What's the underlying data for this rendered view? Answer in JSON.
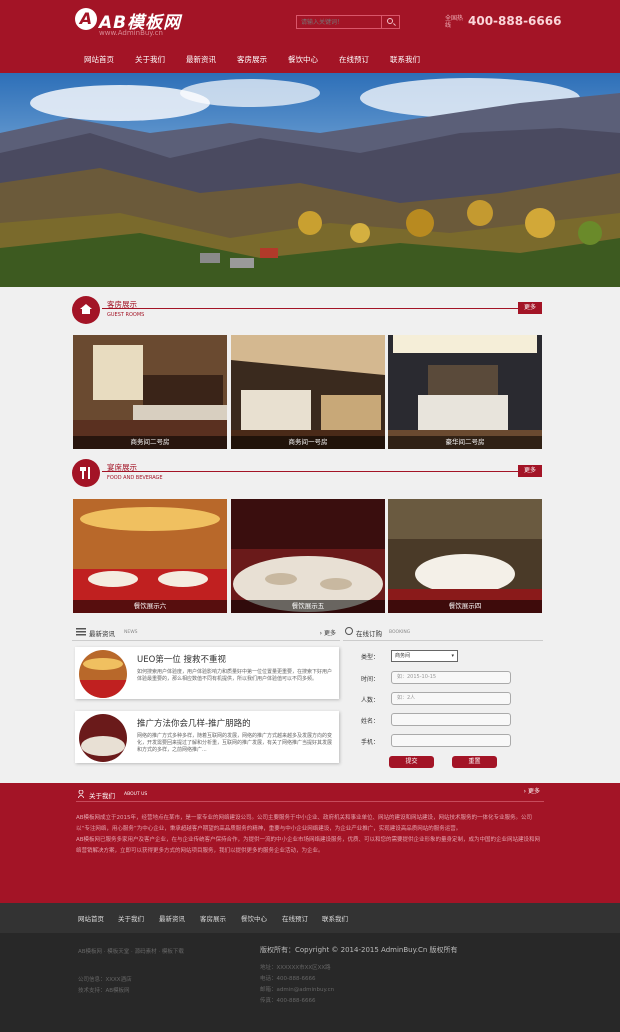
{
  "header": {
    "logo_mark": "A",
    "logo_text": "AB模板网",
    "logo_sub": "www.AdminBuy.cn",
    "search_placeholder": "请输入关键词！",
    "hotline_label": "全国热线",
    "phone": "400-888-6666"
  },
  "nav": [
    "网站首页",
    "关于我们",
    "最新资讯",
    "客房展示",
    "餐饮中心",
    "在线预订",
    "联系我们"
  ],
  "rooms": {
    "title": "客房展示",
    "subtitle": "GUEST ROOMS",
    "more": "更多",
    "items": [
      {
        "caption": "商务间二号房"
      },
      {
        "caption": "商务间一号房"
      },
      {
        "caption": "豪华间二号房"
      }
    ]
  },
  "food": {
    "title": "宴席展示",
    "subtitle": "FOOD AND BEVERAGE",
    "more": "更多",
    "items": [
      {
        "caption": "餐饮展示六"
      },
      {
        "caption": "餐饮展示五"
      },
      {
        "caption": "餐饮展示四"
      }
    ]
  },
  "news": {
    "title": "最新资讯",
    "title_en": "NEWS",
    "more": "更多",
    "items": [
      {
        "title": "UEO第一位 搜救不重视",
        "text": "如何搜索用户体验度，用户体验影响力和质量好中第一位位置量更重要，在搜索下好用户体验最重要的，那么相应数值不同有机提供，所以我们用户体验值可以不同多频。"
      },
      {
        "title": "推广方法你会几样-推广朋路的",
        "text": "网络的推广方式多种多样，随着互联网的发展，网络的推广方式越来越多及发展方向的变化，开发需要回来提过了解和分析重，互联网的推广发展，有关了网络推广当提好其发展和方式的多样，之前网络推广..."
      }
    ]
  },
  "booking": {
    "title": "在线订购",
    "title_en": "BOOKING",
    "fields": [
      {
        "label": "类型：",
        "value": "商务间"
      },
      {
        "label": "时间：",
        "value": "如：2015-10-15"
      },
      {
        "label": "人数：",
        "value": "如：2人"
      },
      {
        "label": "姓名：",
        "value": ""
      },
      {
        "label": "手机：",
        "value": ""
      }
    ],
    "submit": "提交",
    "reset": "重置"
  },
  "about": {
    "title": "关于我们",
    "title_en": "ABOUT US",
    "more": "更多",
    "text1": "AB模板网成立于2015年，经营地点在某市，是一家专业的网络建设公司。公司主要服务于中小企业、政府机关和事业单位、网站的建设和网站建设，网站技术服务的一体化专业服务。公司以“专注网络，用心服务”为中心企业，秉承超越客户期望的高品质服务的精神，重要与中小企业网络建设，为企业产业推广，实现建设高品质网站的服务运营。",
    "text2": "AB模板网已服务多家用户及客户企业，在与企业传统客户保持合作，为提供一流的中小企业市场网络建设服务，优质、可以和您的需要提供企业形象的量身定制，成为中国的企业网站建设和网络营销解决方案，立即可以获得更多方式的网站项目服务，我们以提供更多的服务企业活动，为企业。"
  },
  "footer_nav": [
    "网站首页",
    "关于我们",
    "最新资讯",
    "客房展示",
    "餐饮中心",
    "在线预订",
    "联系我们"
  ],
  "footer": {
    "links": [
      "AB模板网",
      "模板天堂",
      "源码素材",
      "模板下载"
    ],
    "line1": "公司信息：XXXX酒店",
    "line2": "技术支持：AB模板网",
    "copyright": "版权所有：Copyright © 2014-2015 AdminBuy.Cn 版权所有",
    "contact": [
      "地址：XXXXXX市XX区XX路",
      "电话：400-888-6666",
      "邮箱：admin@adminbuy.cn",
      "传真：400-888-6666"
    ]
  },
  "colors": {
    "brand": "#a31426",
    "dark": "#333333",
    "darker": "#282828"
  }
}
